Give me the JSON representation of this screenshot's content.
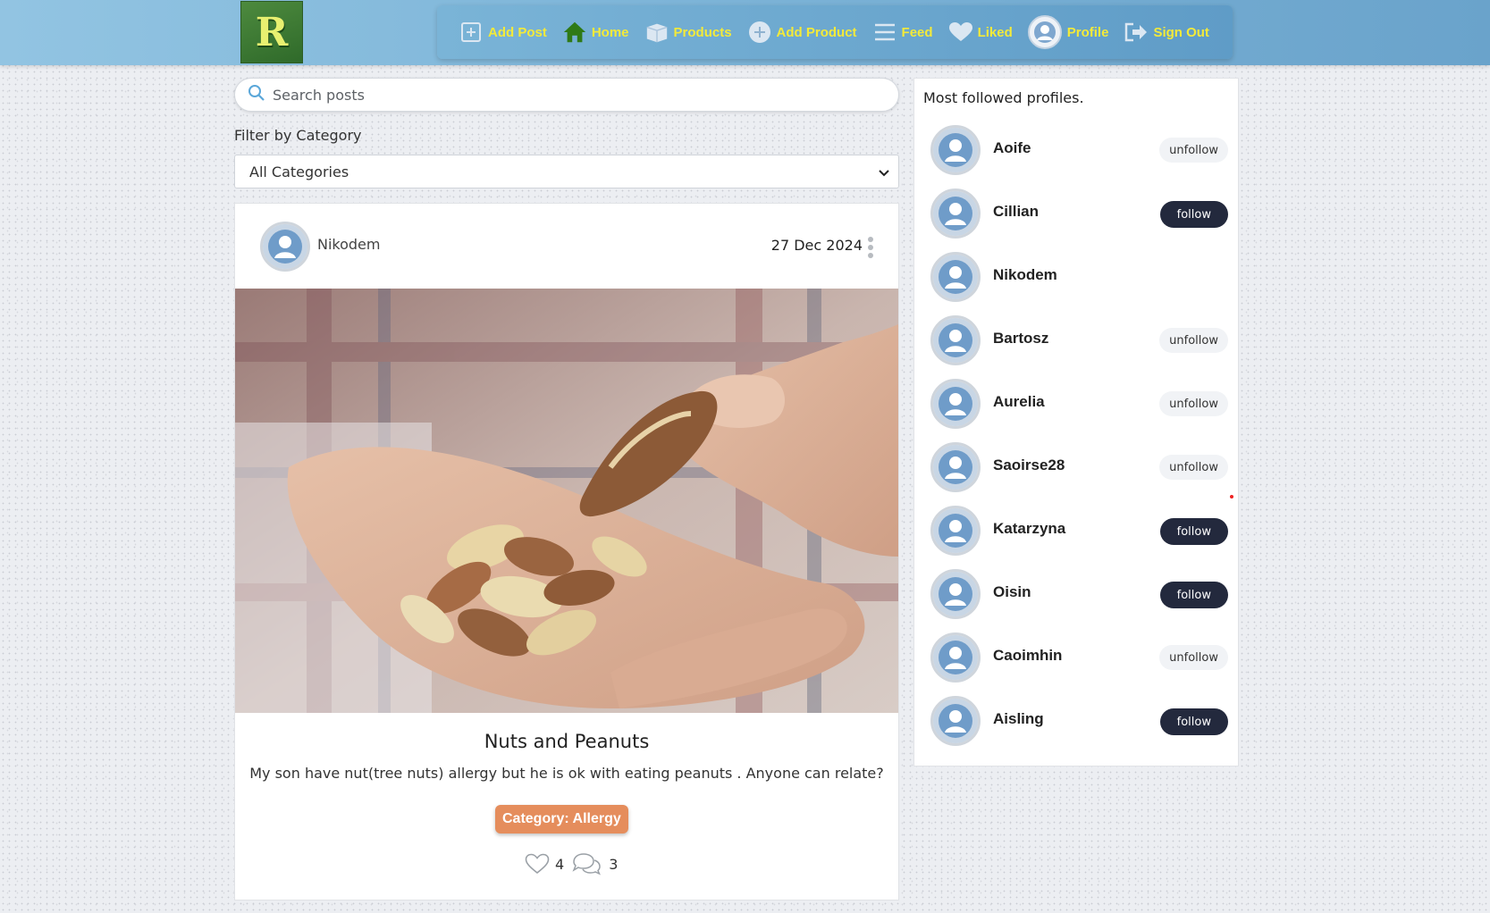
{
  "nav": {
    "logo_letter": "R",
    "items": [
      {
        "label": "Add Post",
        "icon": "plus-square-icon"
      },
      {
        "label": "Home",
        "icon": "home-icon"
      },
      {
        "label": "Products",
        "icon": "box-icon"
      },
      {
        "label": "Add Product",
        "icon": "plus-circle-icon"
      },
      {
        "label": "Feed",
        "icon": "list-icon"
      },
      {
        "label": "Liked",
        "icon": "heart-icon"
      },
      {
        "label": "Profile",
        "icon": "avatar-icon"
      },
      {
        "label": "Sign Out",
        "icon": "sign-out-icon"
      }
    ],
    "text_color": "#f3ea3a"
  },
  "search": {
    "placeholder": "Search posts",
    "value": ""
  },
  "filter": {
    "label": "Filter by Category",
    "selected": "All Categories"
  },
  "post": {
    "author": "Nikodem",
    "date": "27 Dec 2024",
    "title": "Nuts and Peanuts",
    "body": "My son have nut(tree nuts) allergy but he is ok with eating peanuts . Anyone can relate?",
    "category": "Category: Allergy",
    "likes": "4",
    "comments": "3",
    "category_color": "#e58d5c"
  },
  "sidebar": {
    "title": "Most followed profiles.",
    "profiles": [
      {
        "name": "Aoife",
        "action": "unfollow"
      },
      {
        "name": "Cillian",
        "action": "follow"
      },
      {
        "name": "Nikodem",
        "action": ""
      },
      {
        "name": "Bartosz",
        "action": "unfollow"
      },
      {
        "name": "Aurelia",
        "action": "unfollow"
      },
      {
        "name": "Saoirse28",
        "action": "unfollow"
      },
      {
        "name": "Katarzyna",
        "action": "follow"
      },
      {
        "name": "Oisin",
        "action": "follow"
      },
      {
        "name": "Caoimhin",
        "action": "unfollow"
      },
      {
        "name": "Aisling",
        "action": "follow"
      }
    ]
  }
}
